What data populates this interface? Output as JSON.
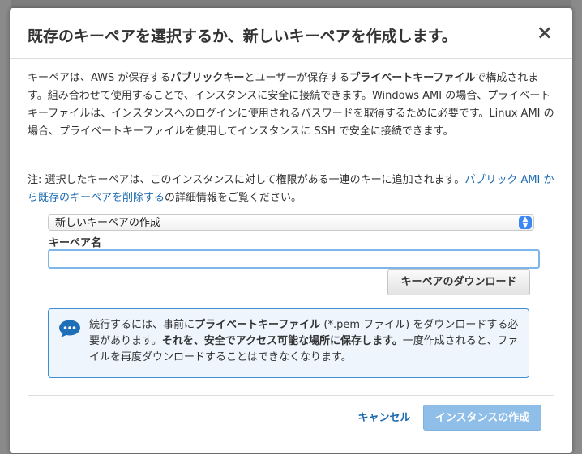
{
  "modal": {
    "title": "既存のキーペアを選択するか、新しいキーペアを作成します。",
    "close_glyph": "×",
    "intro": {
      "p1": "キーペアは、AWS が保存する",
      "b1": "パブリックキー",
      "p2": "とユーザーが保存する",
      "b2": "プライベートキーファイル",
      "p3": "で構成されます。組み合わせて使用することで、インスタンスに安全に接続できます。Windows AMI の場合、プライベートキーファイルは、インスタンスへのログインに使用されるパスワードを取得するために必要です。Linux AMI の場合、プライベートキーファイルを使用してインスタンスに SSH で安全に接続できます。"
    },
    "note": {
      "prefix": "注: 選択したキーペアは、このインスタンスに対して権限がある一連のキーに追加されます。",
      "link": "パブリック AMI から既存のキーペアを削除する",
      "suffix": "の詳細情報をご覧ください。"
    },
    "select": {
      "value": "新しいキーペアの作成",
      "arrow_glyph": "▴▾"
    },
    "keypair_name": {
      "label": "キーペア名",
      "value": ""
    },
    "download_button": "キーペアのダウンロード",
    "info": {
      "p1": "続行するには、事前に",
      "b1": "プライベートキーファイル",
      "p2": " (*.pem ファイル) をダウンロードする必要があります。",
      "b2": "それを、安全でアクセス可能な場所に保存します。",
      "p3": "一度作成されると、ファイルを再度ダウンロードすることはできなくなります。"
    },
    "cancel_button": "キャンセル",
    "launch_button": "インスタンスの作成"
  },
  "colors": {
    "link": "#1b6ab0",
    "info_border": "#3c8fd6",
    "info_bg": "#eef5fc",
    "primary_disabled": "#8fbee8"
  }
}
